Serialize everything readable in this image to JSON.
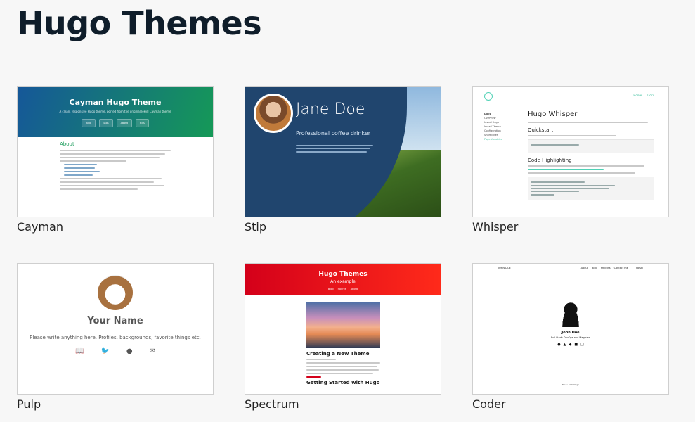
{
  "page": {
    "title": "Hugo Themes"
  },
  "cards": [
    {
      "name": "Cayman",
      "preview": {
        "title": "Cayman Hugo Theme",
        "subtitle": "A clean, responsive Hugo theme, ported from the original Jekyll Cayman theme",
        "buttons": [
          "Blog",
          "Tags",
          "About",
          "RSS"
        ],
        "section_heading": "About"
      }
    },
    {
      "name": "Stip",
      "preview": {
        "person_name": "Jane Doe",
        "role": "Professional coffee drinker"
      }
    },
    {
      "name": "Whisper",
      "preview": {
        "nav": [
          "Home",
          "Docs"
        ],
        "sidebar": [
          "Docs",
          "Overview",
          "Install Hugo",
          "Install Theme",
          "Configuration",
          "Shortcodes",
          "Page Variables"
        ],
        "title": "Hugo Whisper",
        "h_quickstart": "Quickstart",
        "h_code": "Code Highlighting"
      }
    },
    {
      "name": "Pulp",
      "preview": {
        "person_name": "Your Name",
        "description": "Please write anything here. Profiles, backgrounds, favorite things etc.",
        "icons": [
          "book-icon",
          "twitter-icon",
          "github-icon",
          "mail-icon"
        ]
      }
    },
    {
      "name": "Spectrum",
      "preview": {
        "title": "Hugo Themes",
        "subtitle": "An example",
        "nav": [
          "Blog",
          "Source",
          "About"
        ],
        "post_title": "Creating a New Theme",
        "next_title": "Getting Started with Hugo"
      }
    },
    {
      "name": "Coder",
      "preview": {
        "brand": "JOHN DOE",
        "nav": [
          "About",
          "Blog",
          "Projects",
          "Contact me",
          "|",
          "Polski"
        ],
        "person_name": "John Doe",
        "role": "Full Stack DevOps and Magician",
        "footer": "Made with Hugo"
      }
    }
  ]
}
